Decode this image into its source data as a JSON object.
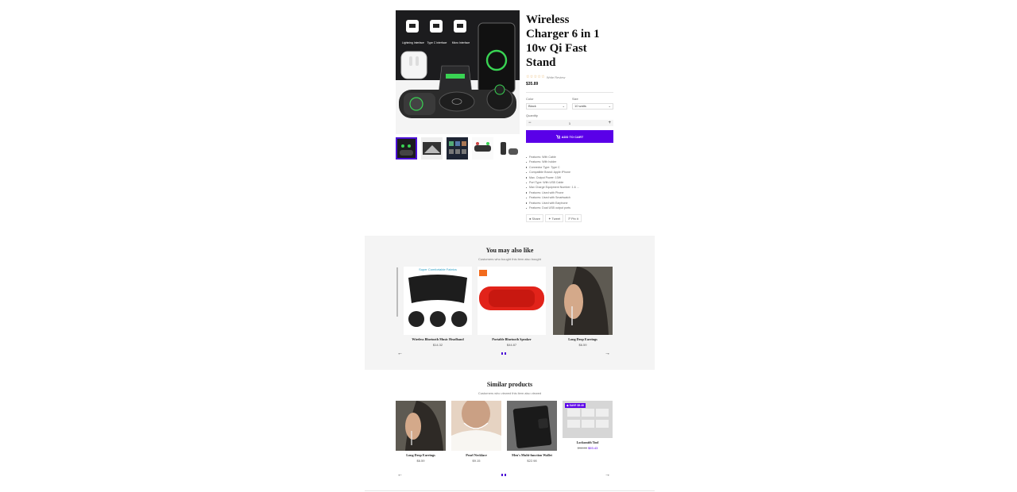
{
  "product": {
    "title": "Wireless Charger 6 in 1 10w Qi Fast Stand",
    "rating_link": "Write Review",
    "price": "$35.89",
    "color_label": "Color",
    "color_value": "Black",
    "size_label": "Size",
    "size_value": "10 watts",
    "quantity_label": "Quantity",
    "quantity_value": "1",
    "add_to_cart": "ADD TO CART",
    "image_overlay": {
      "port_1": "Lightning Interface",
      "port_2": "Type C Interface",
      "port_3": "Micro Interface"
    },
    "features": [
      "Features: With Cable",
      "Features: With holder",
      "Connector Type: Type C",
      "Compatible Brand: Apple iPhone",
      "Max. Output Power: 10W",
      "Port Type: With USB Cable",
      "Max Charge Equipment Number: 1 & ...",
      "Features: Used with Phone",
      "Features: Used with Smartwatch",
      "Features: Used with Earphone",
      "Features: Dual USB output ports"
    ],
    "share": {
      "share": "Share",
      "tweet": "Tweet",
      "pin": "Pin it"
    }
  },
  "you_may_also_like": {
    "title": "You may also like",
    "subtitle": "Customers who bought this item also bought",
    "image_caption": "Super Comfortable Fabrics",
    "items": [
      {
        "name": "Wireless Bluetooth Music Headband",
        "price": "$14.32"
      },
      {
        "name": "Portable Bluetooth Speaker",
        "price": "$44.87"
      },
      {
        "name": "Long Drop Earrings",
        "price": "$6.59"
      }
    ]
  },
  "similar_products": {
    "title": "Similar products",
    "subtitle": "Customers who viewed this item also viewed",
    "sale_badge": "SAVE $9.40",
    "items": [
      {
        "name": "Long Drop Earrings",
        "price": "$6.59"
      },
      {
        "name": "Pearl Necklace",
        "price": "$9.15"
      },
      {
        "name": "Men's Multi-function Wallet",
        "price": "$22.98"
      },
      {
        "name": "Locksmith Tool",
        "old_price": "$96.83",
        "price": "$93.43"
      }
    ]
  },
  "colors": {
    "accent": "#5a00e8",
    "section_bg": "#f4f4f4",
    "star": "#e0a040"
  },
  "icons": [
    "cart-icon",
    "facebook-icon",
    "twitter-icon",
    "pinterest-icon",
    "arrow-left-icon",
    "arrow-right-icon",
    "tag-icon"
  ]
}
